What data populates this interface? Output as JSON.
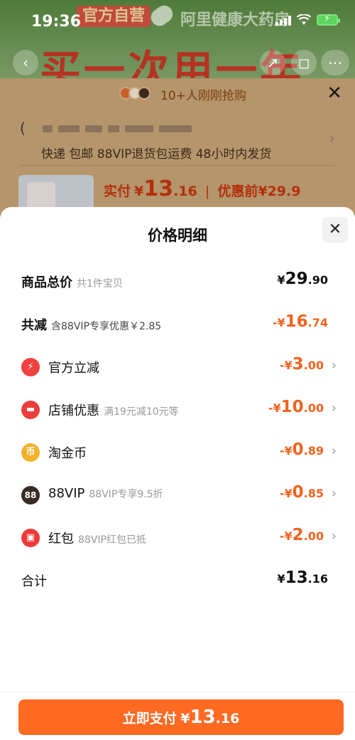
{
  "status_bar": {
    "time": "19:36"
  },
  "banner": {
    "badge": "官方自营",
    "store": "阿里健康大药房",
    "headline": "买一次用一年"
  },
  "nav": {
    "back_icon": "back-icon",
    "share_icon": "share-icon",
    "cart_icon": "cart-icon",
    "more_icon": "more-icon"
  },
  "order_card": {
    "grab_text": "10+人刚刚抢购",
    "shipping": "快递 包邮 88VIP退货包运费 48小时内发货",
    "pay_label": "实付",
    "pay_currency": "¥",
    "pay_int": "13",
    "pay_dec": ".16",
    "before_label": "优惠前¥29.9"
  },
  "sheet": {
    "title": "价格明细",
    "rows": [
      {
        "label": "商品总价",
        "note": "共1件宝贝",
        "cur": "¥",
        "int": "29",
        "dec": ".90"
      },
      {
        "label": "共减",
        "note": "含88VIP专享优惠￥2.85",
        "cur": "-¥",
        "int": "16",
        "dec": ".74"
      },
      {
        "label": "官方立减",
        "note": "",
        "cur": "-¥",
        "int": "3",
        "dec": ".00",
        "icon": "lightning-icon"
      },
      {
        "label": "店铺优惠",
        "note": "满19元减10元等",
        "cur": "-¥",
        "int": "10",
        "dec": ".00",
        "icon": "shop-icon"
      },
      {
        "label": "淘金币",
        "note": "",
        "cur": "-¥",
        "int": "0",
        "dec": ".89",
        "icon": "coin-icon"
      },
      {
        "label": "88VIP",
        "note": "88VIP专享9.5折",
        "cur": "-¥",
        "int": "0",
        "dec": ".85",
        "icon": "vip88-icon",
        "icon_text": "88"
      },
      {
        "label": "红包",
        "note": "88VIP红包已抵",
        "cur": "-¥",
        "int": "2",
        "dec": ".00",
        "icon": "red-envelope-icon"
      },
      {
        "label": "合计",
        "note": "",
        "cur": "¥",
        "int": "13",
        "dec": ".16"
      }
    ],
    "pay_button": {
      "label": "立即支付",
      "cur": "¥",
      "int": "13",
      "dec": ".16"
    }
  },
  "colors": {
    "accent": "#ff6a23",
    "discount": "#f0641e",
    "sheet_bg": "#ffffff"
  }
}
